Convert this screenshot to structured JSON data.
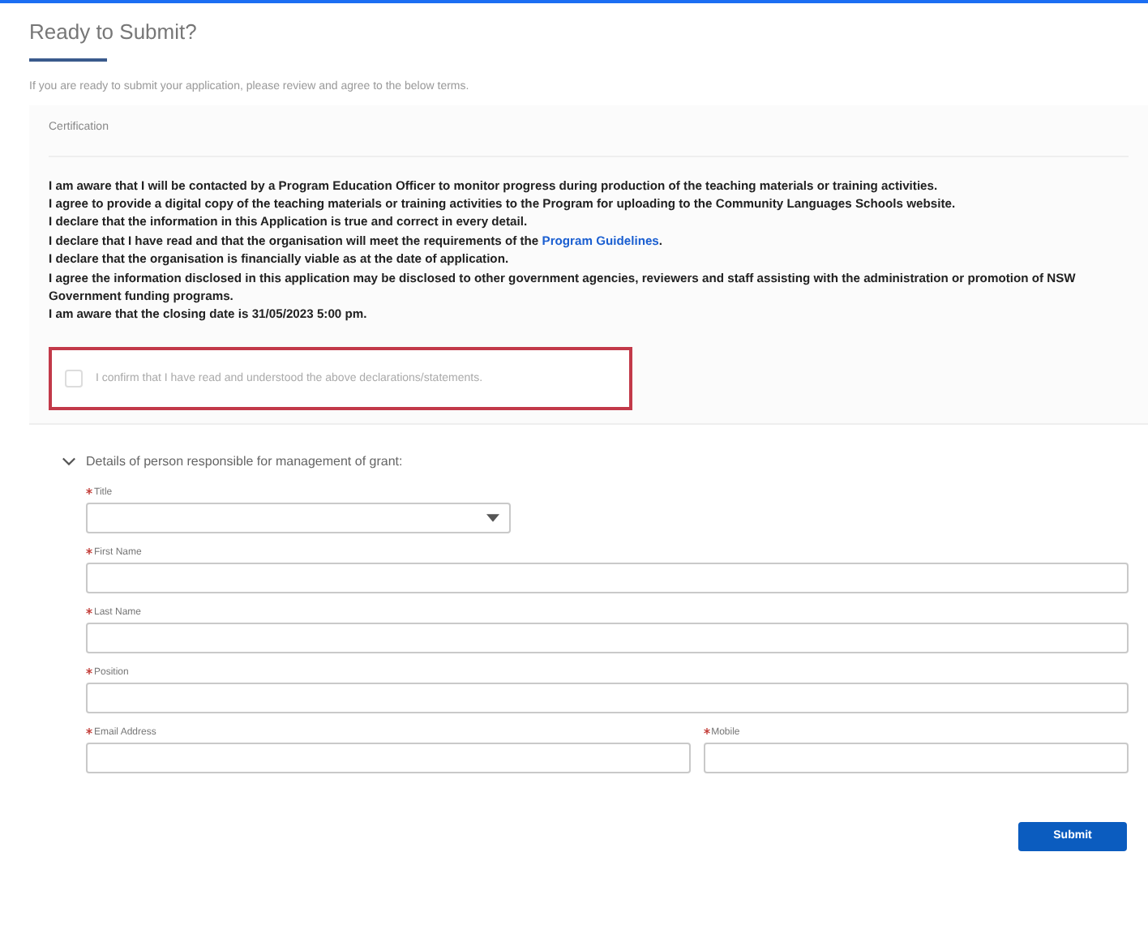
{
  "title": "Ready to Submit?",
  "intro": "If you are ready to submit your application, please review and agree to the below terms.",
  "certification": {
    "heading": "Certification",
    "terms": [
      {
        "text": "I am aware that I will be contacted by a Program Education Officer to monitor progress during production of the teaching materials or training activities."
      },
      {
        "text": "I agree to provide a digital copy of the teaching materials or training activities to the Program for uploading to the Community Languages Schools website."
      },
      {
        "text": "I declare that the information in this Application is true and correct in every detail."
      },
      {
        "text": "I declare that I have read and that the organisation will meet the requirements of the ",
        "link": "Program Guidelines",
        "after": "."
      },
      {
        "text": "I declare that the organisation is financially viable as at the date of application."
      },
      {
        "text": "I agree the information disclosed in this application may be disclosed to other government agencies, reviewers and staff assisting with the administration or promotion of NSW Government funding programs."
      },
      {
        "text": "I am aware that the closing date is  31/05/2023  5:00 pm."
      }
    ],
    "confirm": {
      "label": "I confirm that I have read and understood the above declarations/statements.",
      "checked": false,
      "error": true
    }
  },
  "section": {
    "title": "Details of person responsible for management of grant:",
    "expanded": true,
    "rows": [
      [
        {
          "label": "Title",
          "kind": "select",
          "required": true
        }
      ],
      [
        {
          "label": "First Name",
          "kind": "text",
          "required": true
        }
      ],
      [
        {
          "label": "Last Name",
          "kind": "text",
          "required": true
        }
      ],
      [
        {
          "label": "Position",
          "kind": "text",
          "required": true
        }
      ],
      [
        {
          "label": "Email Address",
          "kind": "text",
          "required": true
        },
        {
          "label": "Mobile",
          "kind": "text",
          "required": true
        }
      ]
    ]
  },
  "submit": "Submit"
}
